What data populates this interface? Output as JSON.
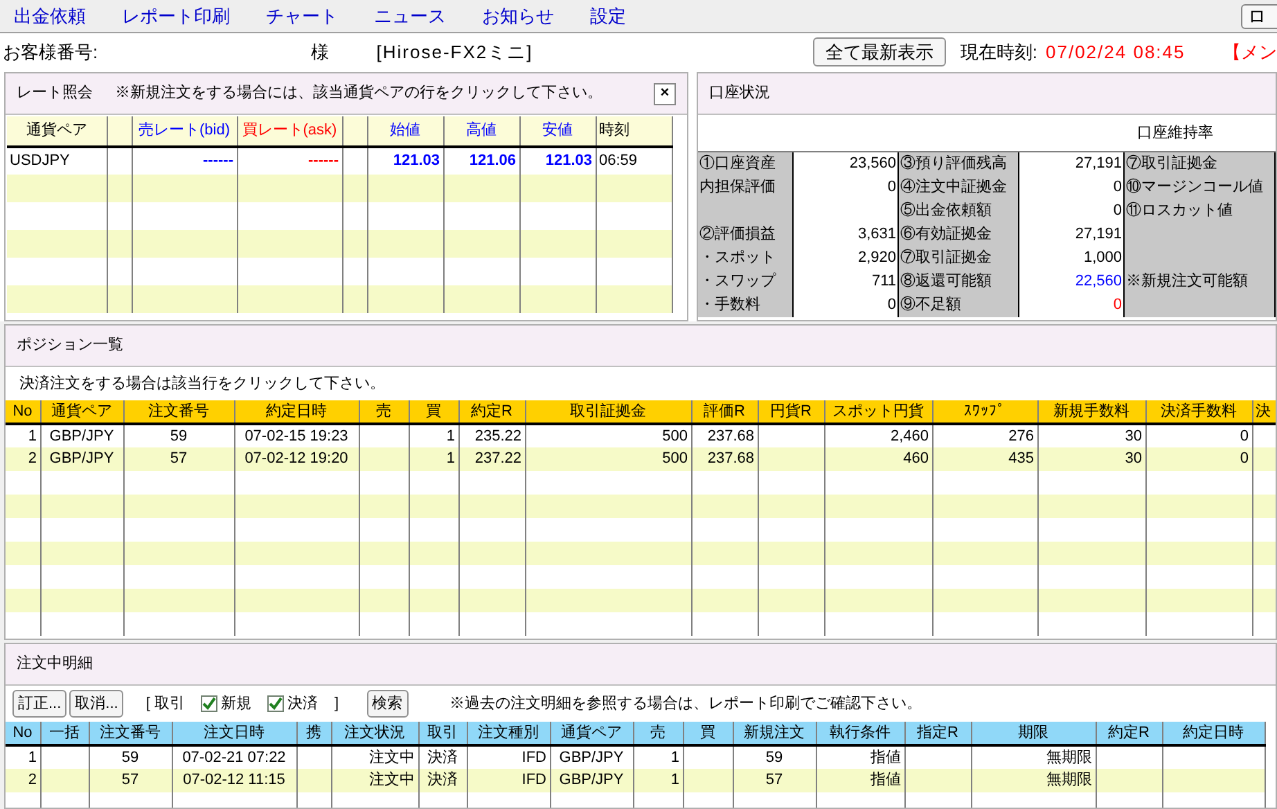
{
  "menu": {
    "items": [
      "出金依頼",
      "レポート印刷",
      "チャート",
      "ニュース",
      "お知らせ",
      "設定"
    ],
    "corner_button": "ロ"
  },
  "header": {
    "customer_label": "お客様番号:",
    "honorific": "様",
    "product": "[Hirose-FX2ミニ]",
    "refresh_button": "全て最新表示",
    "clock_label": "現在時刻:",
    "clock_value": "07/02/24 08:45",
    "notice": "【メン"
  },
  "rates": {
    "title": "レート照会",
    "note": "※新規注文をする場合には、該当通貨ペアの行をクリックして下さい。",
    "close": "×",
    "columns": [
      {
        "label": "通貨ペア",
        "color": "#000000"
      },
      {},
      {
        "label": "売レート(bid)",
        "color": "#0000ff"
      },
      {
        "label": "買レート(ask)",
        "color": "#ff0000"
      },
      {},
      {
        "label": "始値",
        "color": "#0000ff"
      },
      {
        "label": "高値",
        "color": "#0000ff"
      },
      {
        "label": "安値",
        "color": "#0000ff"
      },
      {
        "label": "時刻",
        "color": "#000000"
      }
    ],
    "rows": [
      [
        "USDJPY",
        null,
        "------",
        "------",
        null,
        "121.03",
        "121.06",
        "121.03",
        "06:59"
      ]
    ]
  },
  "account": {
    "title": "口座状況",
    "maintenance_label": "口座維持率",
    "rows": [
      {
        "cells": [
          {
            "text": "①口座資産"
          },
          {
            "text": "23,560",
            "color": "#000000"
          },
          {
            "text": "③預り評価残高"
          },
          {
            "text": "27,191",
            "color": "#000000"
          },
          {
            "text": "⑦取引証拠金"
          }
        ]
      },
      {
        "cells": [
          {
            "text": "内担保評価"
          },
          {
            "text": "0",
            "color": "#000000"
          },
          {
            "text": "④注文中証拠金"
          },
          {
            "text": "0",
            "color": "#000000"
          },
          {
            "text": "⑩マージンコール値"
          }
        ]
      },
      {
        "cells": [
          {},
          {},
          {
            "text": "⑤出金依頼額"
          },
          {
            "text": "0",
            "color": "#000000"
          },
          {
            "text": "⑪ロスカット値"
          }
        ]
      },
      {
        "cells": [
          {
            "text": "②評価損益"
          },
          {
            "text": "3,631",
            "color": "#000000"
          },
          {
            "text": "⑥有効証拠金"
          },
          {
            "text": "27,191",
            "color": "#000000"
          },
          {}
        ]
      },
      {
        "cells": [
          {
            "text": "・スポット"
          },
          {
            "text": "2,920",
            "color": "#000000"
          },
          {
            "text": "⑦取引証拠金"
          },
          {
            "text": "1,000",
            "color": "#000000"
          },
          {}
        ]
      },
      {
        "cells": [
          {
            "text": "・スワップ"
          },
          {
            "text": "711",
            "color": "#000000"
          },
          {
            "text": "⑧返還可能額"
          },
          {
            "text": "22,560",
            "color": "#0000ff"
          },
          {
            "text": "※新規注文可能額"
          }
        ]
      },
      {
        "cells": [
          {
            "text": "・手数料"
          },
          {
            "text": "0",
            "color": "#000000"
          },
          {
            "text": "⑨不足額"
          },
          {
            "text": "0",
            "color": "#ff0000"
          },
          {}
        ]
      }
    ]
  },
  "positions": {
    "title": "ポジション一覧",
    "note": "決済注文をする場合は該当行をクリックして下さい。",
    "columns": [
      "No",
      "通貨ペア",
      "注文番号",
      "約定日時",
      "売",
      "買",
      "約定R",
      "取引証拠金",
      "評価R",
      "円貨R",
      "スポット円貨",
      "ｽﾜｯﾌﾟ",
      "新規手数料",
      "決済手数料",
      "決"
    ],
    "rows": [
      [
        "1",
        "GBP/JPY",
        "59",
        "07-02-15 19:23",
        null,
        "1",
        "235.22",
        "500",
        "237.68",
        null,
        "2,460",
        "276",
        "30",
        "0",
        null
      ],
      [
        "2",
        "GBP/JPY",
        "57",
        "07-02-12 19:20",
        null,
        "1",
        "237.22",
        "500",
        "237.68",
        null,
        "460",
        "435",
        "30",
        "0",
        null
      ]
    ]
  },
  "orders": {
    "title": "注文中明細",
    "buttons": [
      "訂正...",
      "取消..."
    ],
    "filter_open": "[ 取引",
    "filters": [
      {
        "label": "新規",
        "checked": true
      },
      {
        "label": "決済",
        "checked": true
      }
    ],
    "filter_close": "]",
    "search_button": "検索",
    "note": "※過去の注文明細を参照する場合は、レポート印刷でご確認下さい。",
    "columns": [
      "No",
      "一括",
      "注文番号",
      "注文日時",
      "携",
      "注文状況",
      "取引",
      "注文種別",
      "通貨ペア",
      "売",
      "買",
      "新規注文",
      "執行条件",
      "指定R",
      "期限",
      "約定R",
      "約定日時"
    ],
    "rows": [
      [
        "1",
        null,
        "59",
        "07-02-21 07:22",
        null,
        "注文中",
        "決済",
        "IFD",
        "GBP/JPY",
        "1",
        null,
        "59",
        "指値",
        null,
        "無期限",
        null,
        null
      ],
      [
        "2",
        null,
        "57",
        "07-02-12 11:15",
        null,
        "注文中",
        "決済",
        "IFD",
        "GBP/JPY",
        "1",
        null,
        "57",
        "指値",
        null,
        "無期限",
        null,
        null
      ]
    ]
  }
}
